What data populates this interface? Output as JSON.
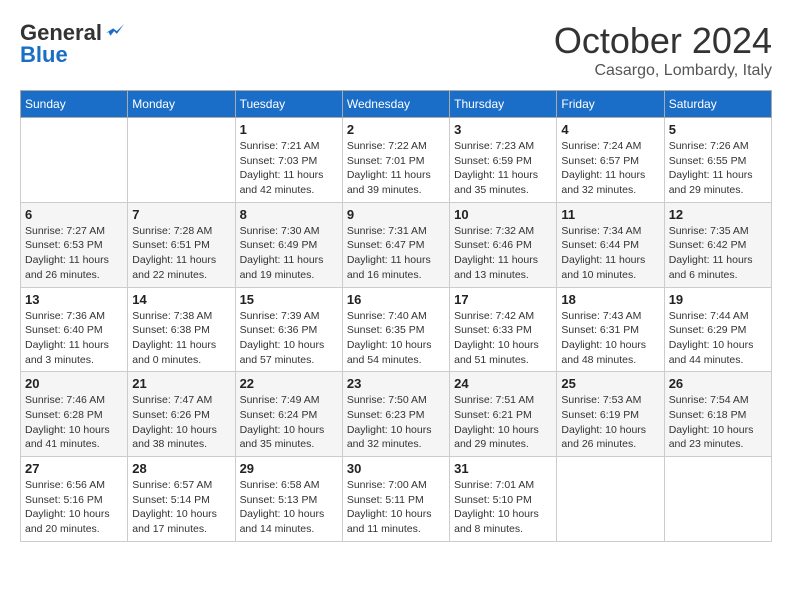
{
  "header": {
    "logo_general": "General",
    "logo_blue": "Blue",
    "month_title": "October 2024",
    "location": "Casargo, Lombardy, Italy"
  },
  "weekdays": [
    "Sunday",
    "Monday",
    "Tuesday",
    "Wednesday",
    "Thursday",
    "Friday",
    "Saturday"
  ],
  "weeks": [
    [
      {
        "day": "",
        "info": ""
      },
      {
        "day": "",
        "info": ""
      },
      {
        "day": "1",
        "info": "Sunrise: 7:21 AM\nSunset: 7:03 PM\nDaylight: 11 hours and 42 minutes."
      },
      {
        "day": "2",
        "info": "Sunrise: 7:22 AM\nSunset: 7:01 PM\nDaylight: 11 hours and 39 minutes."
      },
      {
        "day": "3",
        "info": "Sunrise: 7:23 AM\nSunset: 6:59 PM\nDaylight: 11 hours and 35 minutes."
      },
      {
        "day": "4",
        "info": "Sunrise: 7:24 AM\nSunset: 6:57 PM\nDaylight: 11 hours and 32 minutes."
      },
      {
        "day": "5",
        "info": "Sunrise: 7:26 AM\nSunset: 6:55 PM\nDaylight: 11 hours and 29 minutes."
      }
    ],
    [
      {
        "day": "6",
        "info": "Sunrise: 7:27 AM\nSunset: 6:53 PM\nDaylight: 11 hours and 26 minutes."
      },
      {
        "day": "7",
        "info": "Sunrise: 7:28 AM\nSunset: 6:51 PM\nDaylight: 11 hours and 22 minutes."
      },
      {
        "day": "8",
        "info": "Sunrise: 7:30 AM\nSunset: 6:49 PM\nDaylight: 11 hours and 19 minutes."
      },
      {
        "day": "9",
        "info": "Sunrise: 7:31 AM\nSunset: 6:47 PM\nDaylight: 11 hours and 16 minutes."
      },
      {
        "day": "10",
        "info": "Sunrise: 7:32 AM\nSunset: 6:46 PM\nDaylight: 11 hours and 13 minutes."
      },
      {
        "day": "11",
        "info": "Sunrise: 7:34 AM\nSunset: 6:44 PM\nDaylight: 11 hours and 10 minutes."
      },
      {
        "day": "12",
        "info": "Sunrise: 7:35 AM\nSunset: 6:42 PM\nDaylight: 11 hours and 6 minutes."
      }
    ],
    [
      {
        "day": "13",
        "info": "Sunrise: 7:36 AM\nSunset: 6:40 PM\nDaylight: 11 hours and 3 minutes."
      },
      {
        "day": "14",
        "info": "Sunrise: 7:38 AM\nSunset: 6:38 PM\nDaylight: 11 hours and 0 minutes."
      },
      {
        "day": "15",
        "info": "Sunrise: 7:39 AM\nSunset: 6:36 PM\nDaylight: 10 hours and 57 minutes."
      },
      {
        "day": "16",
        "info": "Sunrise: 7:40 AM\nSunset: 6:35 PM\nDaylight: 10 hours and 54 minutes."
      },
      {
        "day": "17",
        "info": "Sunrise: 7:42 AM\nSunset: 6:33 PM\nDaylight: 10 hours and 51 minutes."
      },
      {
        "day": "18",
        "info": "Sunrise: 7:43 AM\nSunset: 6:31 PM\nDaylight: 10 hours and 48 minutes."
      },
      {
        "day": "19",
        "info": "Sunrise: 7:44 AM\nSunset: 6:29 PM\nDaylight: 10 hours and 44 minutes."
      }
    ],
    [
      {
        "day": "20",
        "info": "Sunrise: 7:46 AM\nSunset: 6:28 PM\nDaylight: 10 hours and 41 minutes."
      },
      {
        "day": "21",
        "info": "Sunrise: 7:47 AM\nSunset: 6:26 PM\nDaylight: 10 hours and 38 minutes."
      },
      {
        "day": "22",
        "info": "Sunrise: 7:49 AM\nSunset: 6:24 PM\nDaylight: 10 hours and 35 minutes."
      },
      {
        "day": "23",
        "info": "Sunrise: 7:50 AM\nSunset: 6:23 PM\nDaylight: 10 hours and 32 minutes."
      },
      {
        "day": "24",
        "info": "Sunrise: 7:51 AM\nSunset: 6:21 PM\nDaylight: 10 hours and 29 minutes."
      },
      {
        "day": "25",
        "info": "Sunrise: 7:53 AM\nSunset: 6:19 PM\nDaylight: 10 hours and 26 minutes."
      },
      {
        "day": "26",
        "info": "Sunrise: 7:54 AM\nSunset: 6:18 PM\nDaylight: 10 hours and 23 minutes."
      }
    ],
    [
      {
        "day": "27",
        "info": "Sunrise: 6:56 AM\nSunset: 5:16 PM\nDaylight: 10 hours and 20 minutes."
      },
      {
        "day": "28",
        "info": "Sunrise: 6:57 AM\nSunset: 5:14 PM\nDaylight: 10 hours and 17 minutes."
      },
      {
        "day": "29",
        "info": "Sunrise: 6:58 AM\nSunset: 5:13 PM\nDaylight: 10 hours and 14 minutes."
      },
      {
        "day": "30",
        "info": "Sunrise: 7:00 AM\nSunset: 5:11 PM\nDaylight: 10 hours and 11 minutes."
      },
      {
        "day": "31",
        "info": "Sunrise: 7:01 AM\nSunset: 5:10 PM\nDaylight: 10 hours and 8 minutes."
      },
      {
        "day": "",
        "info": ""
      },
      {
        "day": "",
        "info": ""
      }
    ]
  ]
}
